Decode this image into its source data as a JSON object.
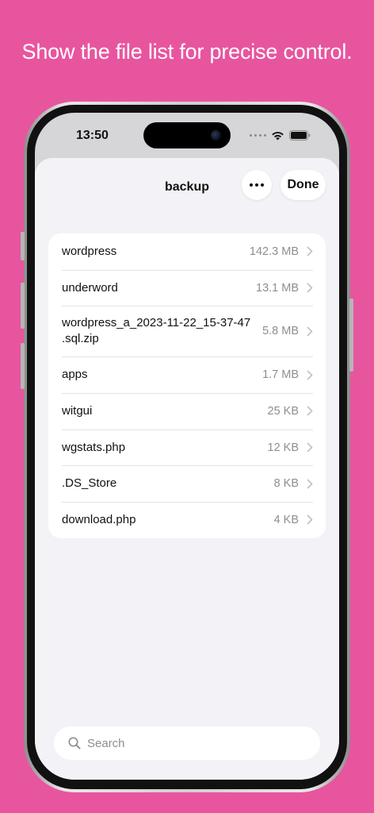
{
  "headline": "Show the file list for precise control.",
  "status_bar": {
    "time": "13:50",
    "icons": [
      "signal-dots-icon",
      "wifi-icon",
      "battery-icon"
    ]
  },
  "nav": {
    "title": "backup",
    "more_icon": "ellipsis-icon",
    "done_label": "Done"
  },
  "files": [
    {
      "name": "wordpress",
      "size": "142.3 MB"
    },
    {
      "name": "underword",
      "size": "13.1 MB"
    },
    {
      "name": "wordpress_a_2023-11-22_15-37-47\n.sql.zip",
      "size": "5.8 MB"
    },
    {
      "name": "apps",
      "size": "1.7 MB"
    },
    {
      "name": "witgui",
      "size": "25 KB"
    },
    {
      "name": "wgstats.php",
      "size": "12 KB"
    },
    {
      "name": ".DS_Store",
      "size": "8 KB"
    },
    {
      "name": "download.php",
      "size": "4 KB"
    }
  ],
  "search": {
    "placeholder": "Search",
    "icon": "search-icon"
  },
  "colors": {
    "background": "#E8559F",
    "sheet": "#F2F2F7",
    "secondary_text": "#8E8E93"
  }
}
